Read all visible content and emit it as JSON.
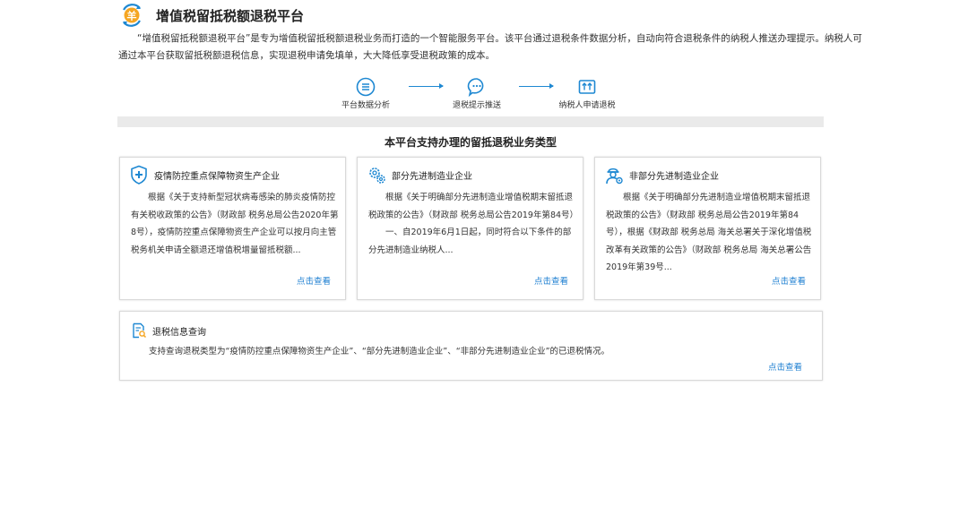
{
  "header": {
    "title": "增值税留抵税额退税平台",
    "logo_icon": "yuan-exchange-icon",
    "logo_symbol": "羊"
  },
  "intro": "“增值税留抵税额退税平台”是专为增值税留抵税额退税业务而打造的一个智能服务平台。该平台通过退税条件数据分析，自动向符合退税条件的纳税人推送办理提示。纳税人可通过本平台获取留抵税额退税信息，实现退税申请免填单，大大降低享受退税政策的成本。",
  "flow": [
    {
      "label": "平台数据分析",
      "icon": "list-circle-icon"
    },
    {
      "label": "退税提示推送",
      "icon": "chat-bubble-icon"
    },
    {
      "label": "纳税人申请退税",
      "icon": "upload-box-icon"
    }
  ],
  "section_title": "本平台支持办理的留抵退税业务类型",
  "cards": [
    {
      "icon": "shield-plus-icon",
      "title": "疫情防控重点保障物资生产企业",
      "paragraphs": [
        "根据《关于支持新型冠状病毒感染的肺炎疫情防控有关税收政策的公告》（财政部 税务总局公告2020年第8号），疫情防控重点保障物资生产企业可以按月向主管税务机关申请全额退还增值税增量留抵税额..."
      ],
      "link": "点击查看"
    },
    {
      "icon": "gears-icon",
      "title": "部分先进制造业企业",
      "paragraphs": [
        "根据《关于明确部分先进制造业增值税期末留抵退税政策的公告》（财政部 税务总局公告2019年第84号）",
        "一、自2019年6月1日起，同时符合以下条件的部分先进制造业纳税人..."
      ],
      "link": "点击查看"
    },
    {
      "icon": "worker-icon",
      "title": "非部分先进制造业企业",
      "paragraphs": [
        "根据《关于明确部分先进制造业增值税期末留抵退税政策的公告》（财政部 税务总局公告2019年第84号），根据《财政部 税务总局 海关总署关于深化增值税改革有关政策的公告》（财政部 税务总局 海关总署公告2019年第39号..."
      ],
      "link": "点击查看"
    }
  ],
  "query": {
    "icon": "document-search-icon",
    "title": "退税信息查询",
    "desc": "支持查询退税类型为“疫情防控重点保障物资生产企业”、“部分先进制造业企业”、“非部分先进制造业企业”的已退税情况。",
    "link": "点击查看"
  },
  "colors": {
    "accent": "#1e88d2",
    "link": "#1e7fd1",
    "logo_orange": "#f5a623",
    "divider": "#eaeaea"
  }
}
